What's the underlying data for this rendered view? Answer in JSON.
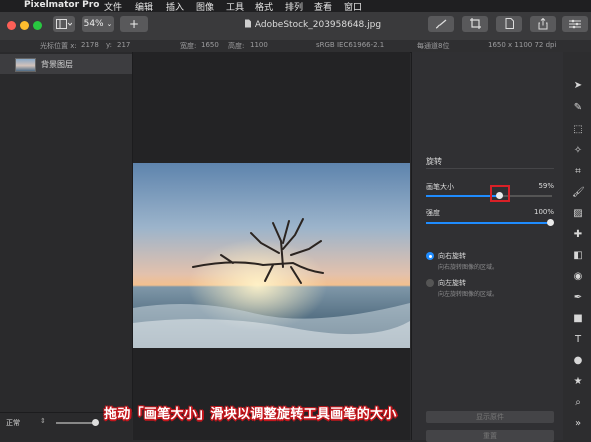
{
  "menubar": {
    "app_name": "Pixelmator Pro",
    "items": [
      "文件",
      "编辑",
      "插入",
      "图像",
      "工具",
      "格式",
      "排列",
      "查看",
      "窗口"
    ]
  },
  "toolbar": {
    "zoom": "54%",
    "add_label": "+",
    "filename": "AdobeStock_203958648.jpg"
  },
  "infobar": {
    "cursor_label": "光标位置 x:",
    "cursor_x": "2178",
    "cursor_y_label": "y:",
    "cursor_y": "217",
    "width_label": "宽度:",
    "width": "1650",
    "height_label": "高度:",
    "height": "1100",
    "color_profile": "sRGB IEC61966-2.1",
    "bit_depth": "每通道8位",
    "dimensions": "1650 x 1100 72 dpi"
  },
  "layers": {
    "items": [
      {
        "name": "背景图层"
      }
    ]
  },
  "panel": {
    "section_title": "旋转",
    "brush_size": {
      "label": "画笔大小",
      "value_text": "59%",
      "value": 0.59
    },
    "strength": {
      "label": "强度",
      "value_text": "100%",
      "value": 1.0
    },
    "rotate_right": {
      "title": "向右旋转",
      "desc": "向右旋转图像的区域。",
      "selected": true
    },
    "rotate_left": {
      "title": "向左旋转",
      "desc": "向左旋转图像的区域。",
      "selected": false
    },
    "show_original": "显示原件",
    "reset": "重置"
  },
  "bottom": {
    "blend_mode": "正常"
  },
  "caption": "拖动「画笔大小」滑块以调整旋转工具画笔的大小",
  "colors": {
    "accent": "#1f8cff",
    "highlight": "#d92027"
  },
  "tools": [
    "arrange-icon",
    "style-icon",
    "select-icon",
    "magic-wand-icon",
    "crop-icon",
    "paint-icon",
    "gradient-icon",
    "retouch-icon",
    "eraser-icon",
    "distort-icon",
    "pen-icon",
    "shape-icon",
    "type-icon",
    "color-icon",
    "effects-icon",
    "zoom-icon",
    "more-icon"
  ]
}
